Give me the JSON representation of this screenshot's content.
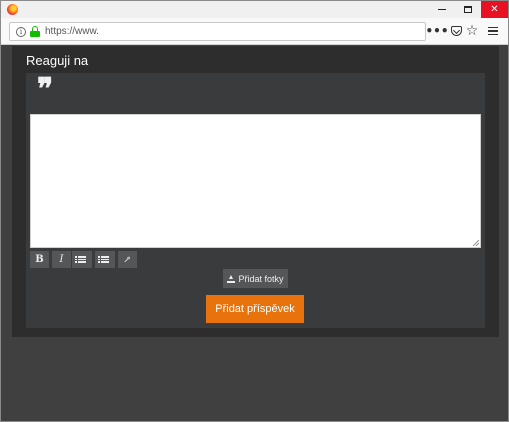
{
  "browser": {
    "url": "https://www.",
    "icons": {
      "logo": "firefox-logo-icon",
      "info": "info-icon",
      "lock": "lock-icon",
      "more": "more-actions-icon",
      "pocket": "pocket-icon",
      "bookmark": "star-icon",
      "menu": "hamburger-menu-icon"
    },
    "info_glyph": "i",
    "more_glyph": "•••",
    "star_glyph": "☆",
    "close_glyph": "✕"
  },
  "reply": {
    "heading": "Reaguji na",
    "quote_glyph": "❞",
    "toolbar": {
      "bold_label": "B",
      "italic_label": "I",
      "link_glyph": "⊸"
    },
    "add_photos_label": "Přidat fotky",
    "submit_label": "Přidat příspěvek"
  },
  "colors": {
    "accent": "#e8730c",
    "panel": "#3a3b3c",
    "page_bg": "#404040",
    "lock_green": "#12bc00",
    "close_red": "#e81123"
  }
}
